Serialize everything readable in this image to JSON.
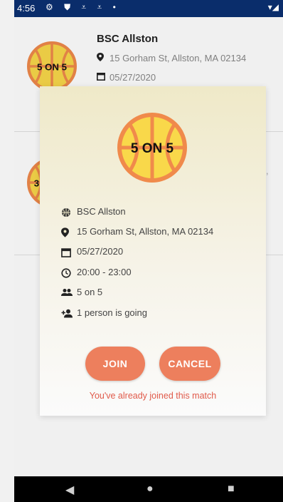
{
  "status_bar": {
    "time": "4:56",
    "icons": "⚙ ⛊ ⩡ ⩡ •",
    "right": "▾◢"
  },
  "list": [
    {
      "ball_text": "5 ON 5",
      "title": "BSC Allston",
      "address": "15 Gorham St, Allston, MA 02134",
      "date": "05/27/2020"
    },
    {
      "ball_text": "3",
      "edge_text_1": ",",
      "edge_text_2": ","
    }
  ],
  "dialog": {
    "ball_text": "5 ON 5",
    "details": {
      "venue": "BSC Allston",
      "address": "15 Gorham St, Allston, MA 02134",
      "date": "05/27/2020",
      "time": "20:00 - 23:00",
      "format": "5 on 5",
      "attendees": "1 person is going"
    },
    "join_label": "JOIN",
    "cancel_label": "CANCEL",
    "message": "You've already joined this match"
  },
  "navbar": {
    "back": "◀",
    "home": "●",
    "recent": "■"
  },
  "colors": {
    "status_bar": "#0a2d6b",
    "button": "#ed7f5d",
    "message": "#e05a4a",
    "ball_fill": "#f9d84a",
    "ball_rim": "#f08a4b"
  },
  "icons": [
    "basketball-icon",
    "location-pin-icon",
    "calendar-icon",
    "clock-icon",
    "group-icon",
    "person-add-icon"
  ]
}
